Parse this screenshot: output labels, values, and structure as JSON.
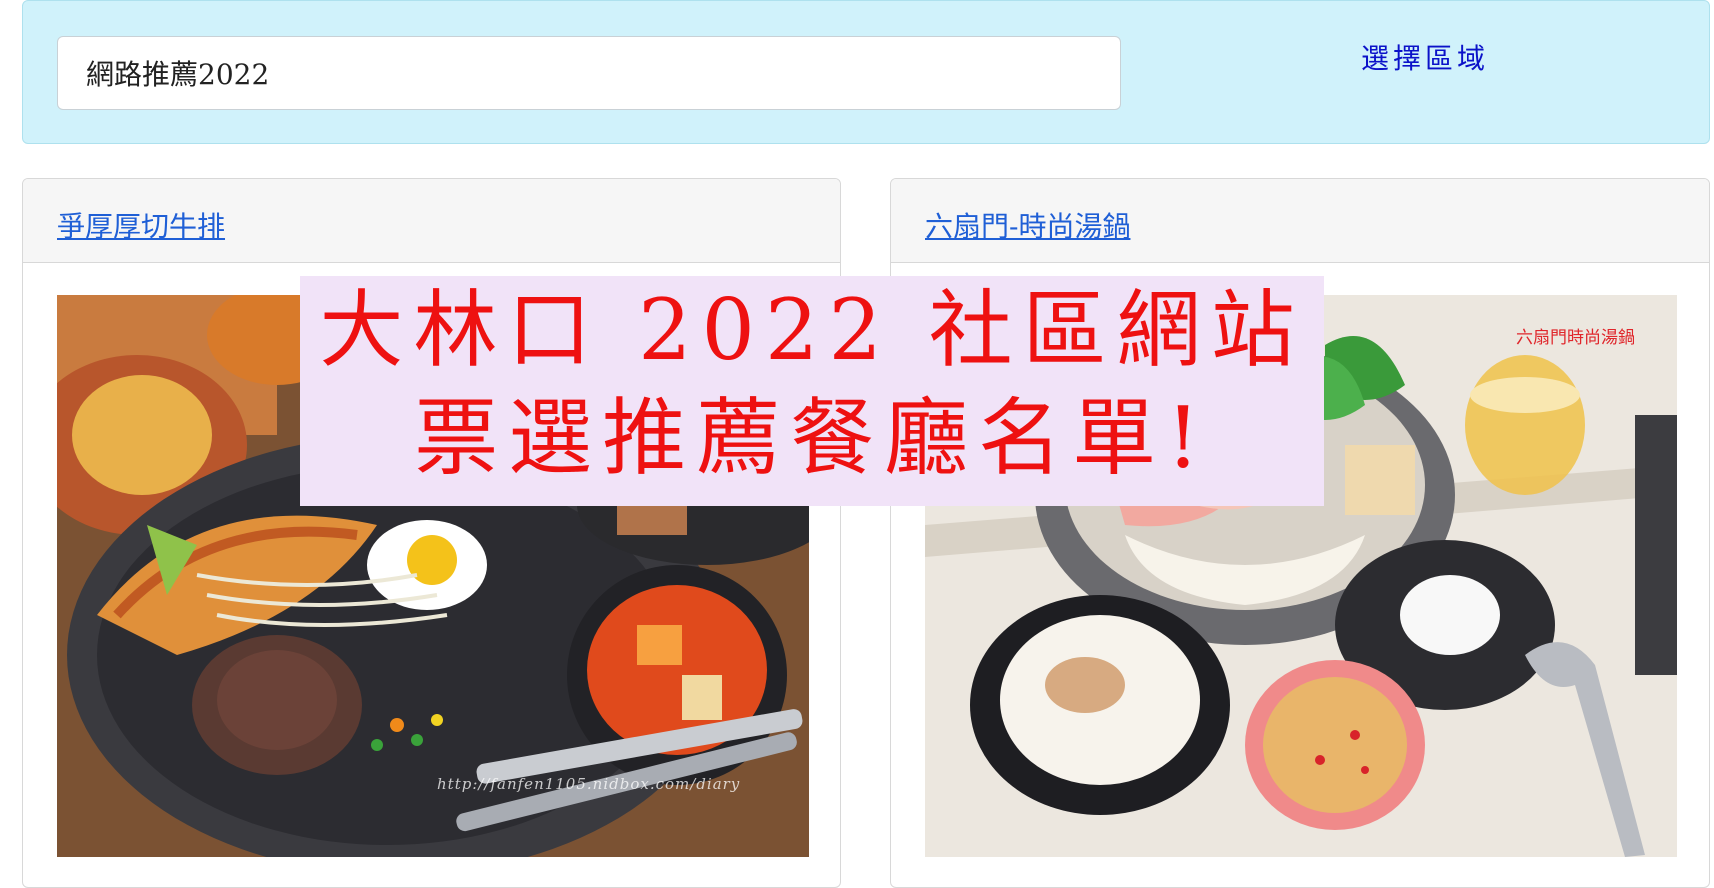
{
  "search": {
    "value": "網路推薦2022"
  },
  "header": {
    "region_link": "選擇區域"
  },
  "restaurants": [
    {
      "name": "爭厚厚切牛排",
      "photo_credit": "http://fanfen1105.nidbox.com/diary"
    },
    {
      "name": "六扇門-時尚湯鍋",
      "photo_watermark": "六扇門時尚湯鍋"
    }
  ],
  "banner": {
    "line1": "大林口 2022 社區網站",
    "line2": "票選推薦餐廳名單!"
  },
  "colors": {
    "top_panel_bg": "#d0f2fb",
    "link_blue": "#1f5fd6",
    "region_link": "#0b12c9",
    "banner_bg": "#f1e3f8",
    "banner_text": "#ee1111"
  }
}
